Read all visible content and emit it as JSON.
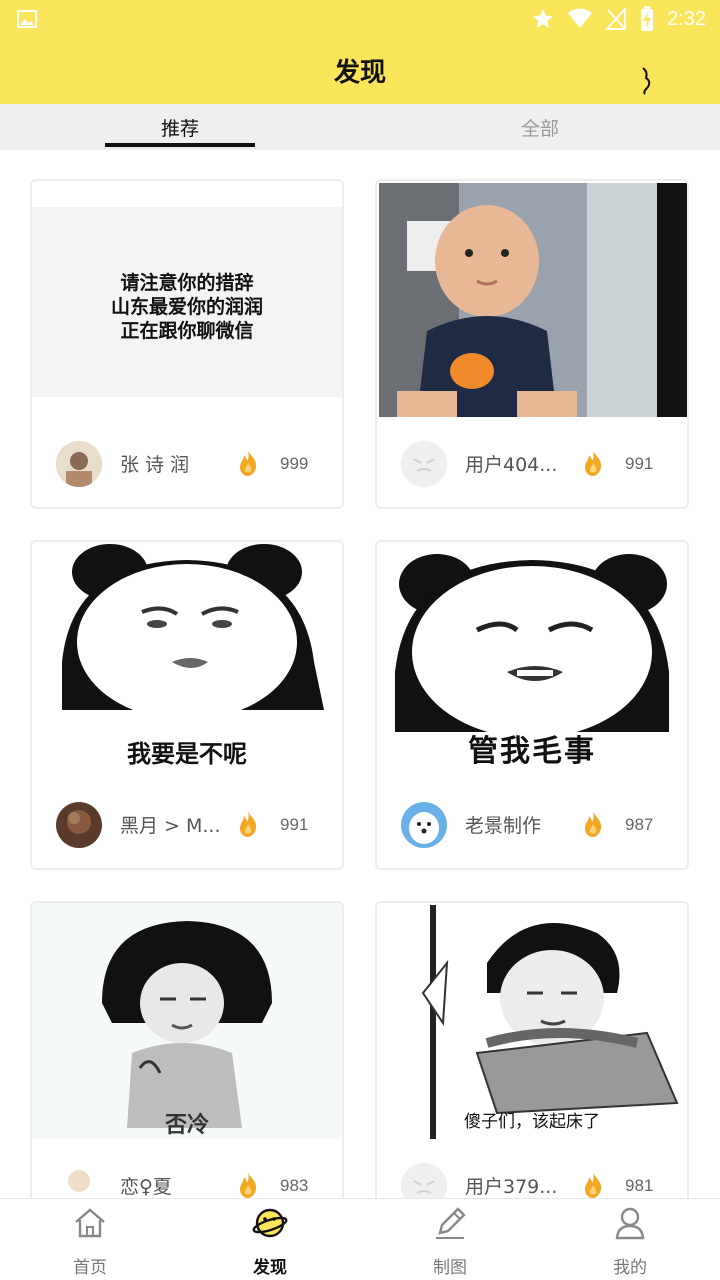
{
  "status_bar": {
    "time": "2:32"
  },
  "app_bar": {
    "title": "发现"
  },
  "tabs": [
    {
      "label": "推荐",
      "active": true
    },
    {
      "label": "全部",
      "active": false
    }
  ],
  "cards": [
    {
      "image_text": [
        "请注意你的措辞",
        "山东最爱你的润润",
        "正在跟你聊微信"
      ],
      "username": "张 诗 润",
      "hot_count": "999"
    },
    {
      "username": "用户404...",
      "hot_count": "991"
    },
    {
      "image_text": [
        "我要是不呢"
      ],
      "username": "黑月 > M...",
      "hot_count": "991"
    },
    {
      "image_text": [
        "管我毛事"
      ],
      "username": "老景制作",
      "hot_count": "987"
    },
    {
      "image_text": [
        "否冷"
      ],
      "username": "恋♀夏",
      "hot_count": "983"
    },
    {
      "image_text": [
        "傻子们，该起床了"
      ],
      "username": "用户379...",
      "hot_count": "981"
    }
  ],
  "bottom_nav": [
    {
      "label": "首页",
      "icon": "home-icon",
      "active": false
    },
    {
      "label": "发现",
      "icon": "planet-icon",
      "active": true
    },
    {
      "label": "制图",
      "icon": "pencil-icon",
      "active": false
    },
    {
      "label": "我的",
      "icon": "profile-icon",
      "active": false
    }
  ],
  "colors": {
    "brand_yellow": "#fbe55a",
    "flame_orange": "#f5a623"
  }
}
